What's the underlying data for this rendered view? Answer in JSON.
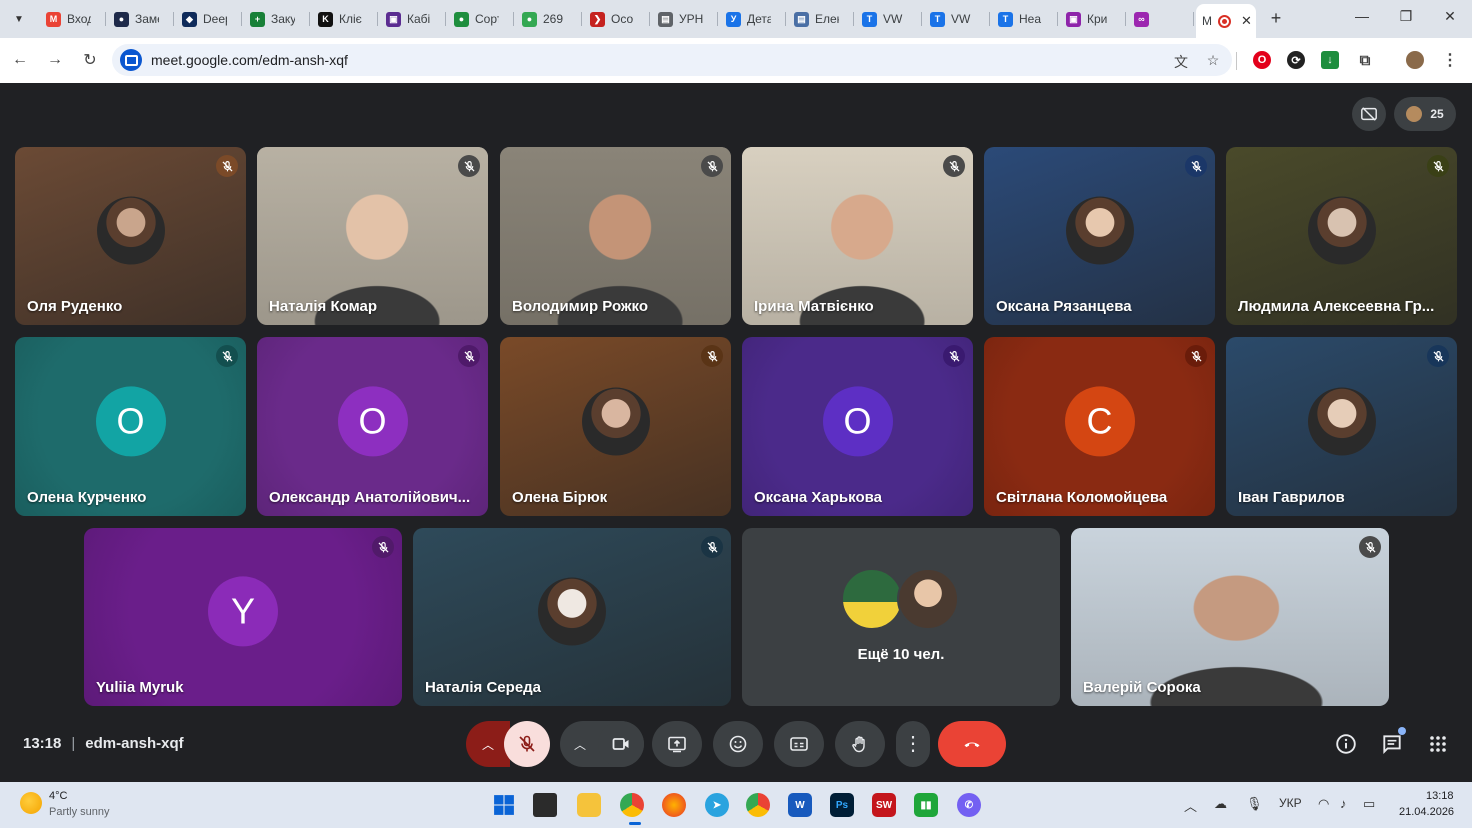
{
  "browser": {
    "tabs": [
      {
        "label": "Вход",
        "color": "#ea4335",
        "glyph": "M"
      },
      {
        "label": "Заме",
        "color": "#1e2a4a",
        "glyph": "●"
      },
      {
        "label": "Deep",
        "color": "#0f2b5b",
        "glyph": "◆"
      },
      {
        "label": "Заку",
        "color": "#188038",
        "glyph": "+"
      },
      {
        "label": "Кліє",
        "color": "#111111",
        "glyph": "K"
      },
      {
        "label": "Кабі",
        "color": "#5b2c91",
        "glyph": "▣"
      },
      {
        "label": "Сорт",
        "color": "#1e8e3e",
        "glyph": "●"
      },
      {
        "label": "269",
        "color": "#34a853",
        "glyph": "●"
      },
      {
        "label": "Осо",
        "color": "#c5221f",
        "glyph": "❯"
      },
      {
        "label": "УРН",
        "color": "#5f6368",
        "glyph": "▤"
      },
      {
        "label": "Дета",
        "color": "#1a73e8",
        "glyph": "У"
      },
      {
        "label": "Елек",
        "color": "#4a6fa5",
        "glyph": "▤"
      },
      {
        "label": "VW",
        "color": "#1a73e8",
        "glyph": "T"
      },
      {
        "label": "VW",
        "color": "#1a73e8",
        "glyph": "T"
      },
      {
        "label": "Неа",
        "color": "#1a73e8",
        "glyph": "T"
      },
      {
        "label": "Кри",
        "color": "#8e24aa",
        "glyph": "▣"
      },
      {
        "label": "",
        "color": "#9c27b0",
        "glyph": "∞"
      },
      {
        "label": "",
        "color": "#5e97f6",
        "glyph": "◗"
      }
    ],
    "active_tab": {
      "label": "M",
      "color": "#d93025"
    },
    "url": "meet.google.com/edm-ansh-xqf"
  },
  "meet": {
    "participant_count": "25",
    "participants": [
      {
        "name": "Оля Руденко",
        "kind": "photo",
        "bg": "#6b4a35",
        "photo": "#c9a58c",
        "mic_bg": "#7b4a28"
      },
      {
        "name": "Наталія Комар",
        "kind": "video",
        "bg": "#b8b1a3",
        "photo": "#e3c2a8",
        "mic_bg": "#4a4a4a"
      },
      {
        "name": "Володимир Рожко",
        "kind": "video",
        "bg": "#8a8478",
        "photo": "#c49477",
        "mic_bg": "#4a4a4a"
      },
      {
        "name": "Ірина Матвієнко",
        "kind": "video",
        "bg": "#d8d0c0",
        "photo": "#d7a98c",
        "mic_bg": "#4a4a4a"
      },
      {
        "name": "Оксана Рязанцева",
        "kind": "photo",
        "bg": "#2b4a78",
        "photo": "#e7c8ae",
        "mic_bg": "#1b3768"
      },
      {
        "name": "Людмила Алексеевна Гр...",
        "kind": "photo",
        "bg": "#4a4a2a",
        "photo": "#d8c2b0",
        "mic_bg": "#3a4016"
      },
      {
        "name": "Олена Курченко",
        "kind": "letter",
        "bg": "#1e6b6b",
        "letter": "О",
        "letter_bg": "#12a4a4",
        "mic_bg": "#134f4f"
      },
      {
        "name": "Олександр Анатолійович...",
        "kind": "letter",
        "bg": "#6a2a8a",
        "letter": "О",
        "letter_bg": "#8d2fc0",
        "mic_bg": "#4f1a6a"
      },
      {
        "name": "Олена Бірюк",
        "kind": "photo",
        "bg": "#7a4a28",
        "photo": "#d9b6a0",
        "mic_bg": "#5a3416"
      },
      {
        "name": "Оксана Харькова",
        "kind": "letter",
        "bg": "#4b2a8a",
        "letter": "О",
        "letter_bg": "#5d2fc4",
        "mic_bg": "#3a1a70"
      },
      {
        "name": "Світлана Коломойцева",
        "kind": "letter",
        "bg": "#8a2a12",
        "letter": "С",
        "letter_bg": "#d44612",
        "mic_bg": "#6a1c0a"
      },
      {
        "name": "Іван Гаврилов",
        "kind": "photo",
        "bg": "#2b4a6a",
        "photo": "#e6cdb8",
        "mic_bg": "#18365a"
      },
      {
        "name": "Yuliia Myruk",
        "kind": "letter",
        "bg": "#6a1e8a",
        "letter": "Y",
        "letter_bg": "#8b2bb8",
        "mic_bg": "#511a6a"
      },
      {
        "name": "Наталія Середа",
        "kind": "photo",
        "bg": "#2e4a5a",
        "photo": "#efe8e2",
        "mic_bg": "#1a3444"
      },
      {
        "name": "Валерій Сорока",
        "kind": "video",
        "bg": "#c9d3dc",
        "photo": "#c59a80",
        "mic_bg": "#4a4a4a"
      }
    ],
    "others_label": "Ещё 10 чел.",
    "time": "13:18",
    "meeting_code": "edm-ansh-xqf"
  },
  "taskbar": {
    "temperature": "4°C",
    "weather": "Partly sunny",
    "language": "УКР",
    "clock_time": "13:18",
    "clock_date": "21.04.2026"
  },
  "colors": {
    "end_call": "#ea4335",
    "mic_off": "#f9dedc",
    "mic_off_toggle": "#8c1d18"
  }
}
